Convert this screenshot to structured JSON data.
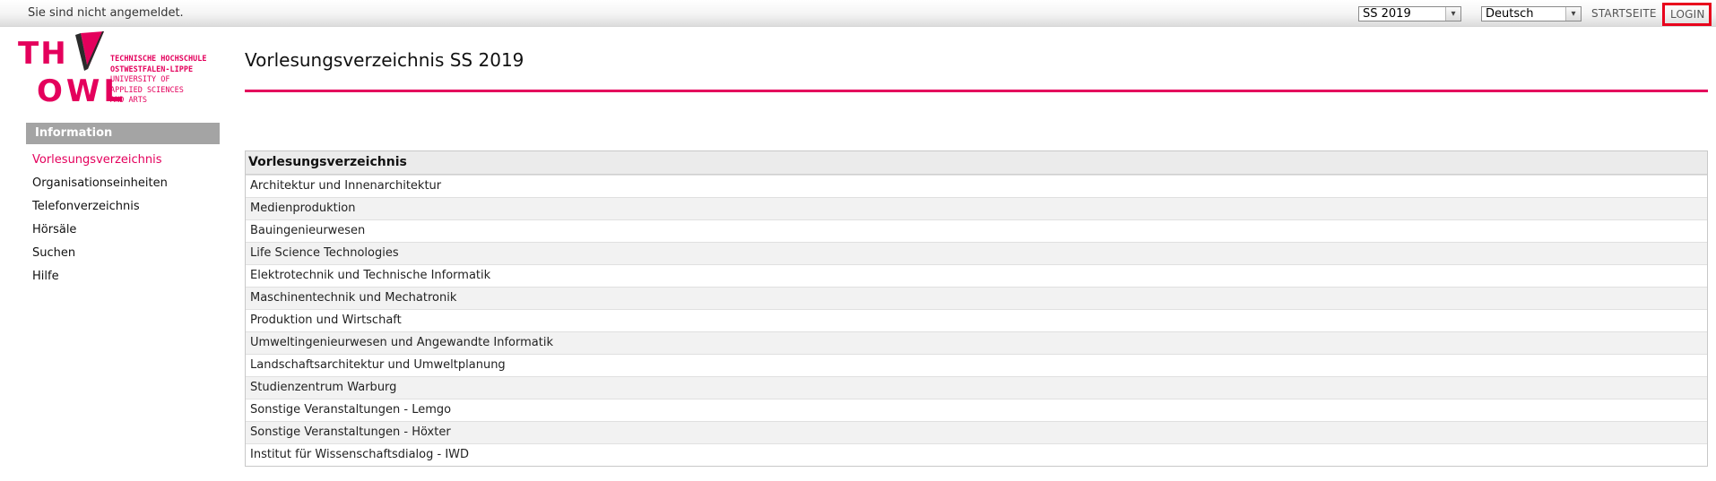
{
  "topbar": {
    "status": "Sie sind nicht angemeldet.",
    "semester_select": "SS 2019",
    "language_select": "Deutsch",
    "home_link": "STARTSEITE",
    "login_link": "LOGIN"
  },
  "logo": {
    "th": "TH",
    "owl": "OWL",
    "lines": [
      "TECHNISCHE HOCHSCHULE",
      "OSTWESTFALEN-LIPPE",
      "UNIVERSITY OF",
      "APPLIED SCIENCES",
      "AND ARTS"
    ],
    "brand_color": "#e4005c"
  },
  "sidebar": {
    "header": "Information",
    "items": [
      {
        "label": "Vorlesungsverzeichnis",
        "active": true
      },
      {
        "label": "Organisationseinheiten"
      },
      {
        "label": "Telefonverzeichnis"
      },
      {
        "label": "Hörsäle"
      },
      {
        "label": "Suchen"
      },
      {
        "label": "Hilfe"
      }
    ]
  },
  "main": {
    "title": "Vorlesungsverzeichnis SS 2019",
    "table_header": "Vorlesungsverzeichnis",
    "rows": [
      "Architektur und Innenarchitektur",
      "Medienproduktion",
      "Bauingenieurwesen",
      "Life Science Technologies",
      "Elektrotechnik und Technische Informatik",
      "Maschinentechnik und Mechatronik",
      "Produktion und Wirtschaft",
      "Umweltingenieurwesen und Angewandte Informatik",
      "Landschaftsarchitektur und Umweltplanung",
      "Studienzentrum Warburg",
      "Sonstige Veranstaltungen - Lemgo",
      "Sonstige Veranstaltungen - Höxter",
      "Institut für Wissenschaftsdialog - IWD"
    ]
  }
}
